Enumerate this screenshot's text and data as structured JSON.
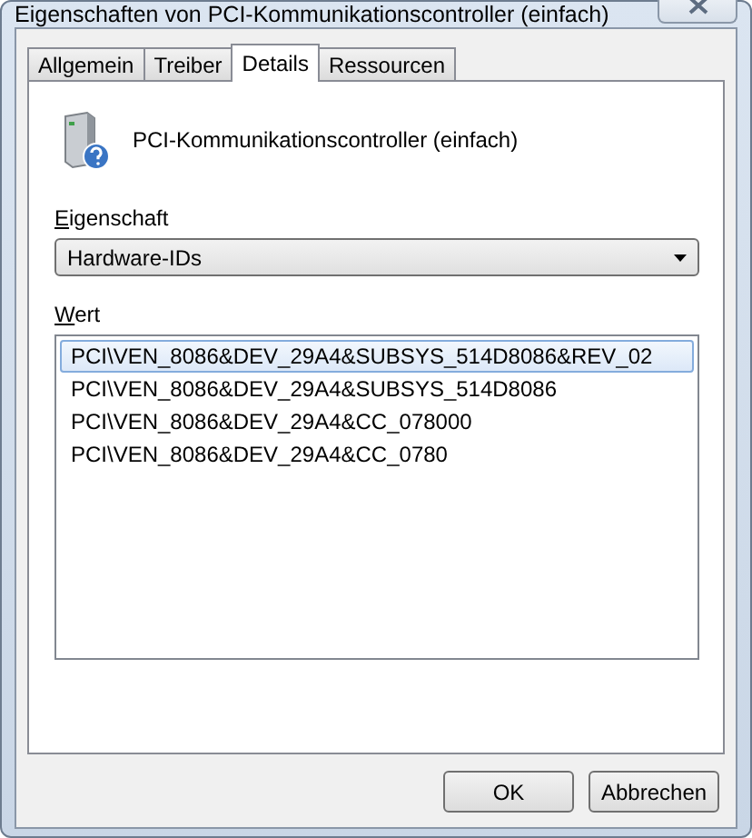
{
  "window": {
    "title": "Eigenschaften von PCI-Kommunikationscontroller (einfach)"
  },
  "tabs": [
    {
      "label": "Allgemein",
      "selected": false
    },
    {
      "label": "Treiber",
      "selected": false
    },
    {
      "label": "Details",
      "selected": true
    },
    {
      "label": "Ressourcen",
      "selected": false
    }
  ],
  "device": {
    "name": "PCI-Kommunikationscontroller (einfach)"
  },
  "property": {
    "label": "Eigenschaft",
    "value": "Hardware-IDs"
  },
  "values": {
    "label": "Wert",
    "items": [
      {
        "text": "PCI\\VEN_8086&DEV_29A4&SUBSYS_514D8086&REV_02",
        "selected": true
      },
      {
        "text": "PCI\\VEN_8086&DEV_29A4&SUBSYS_514D8086",
        "selected": false
      },
      {
        "text": "PCI\\VEN_8086&DEV_29A4&CC_078000",
        "selected": false
      },
      {
        "text": "PCI\\VEN_8086&DEV_29A4&CC_0780",
        "selected": false
      }
    ]
  },
  "buttons": [
    "OK",
    "Abbrechen"
  ]
}
